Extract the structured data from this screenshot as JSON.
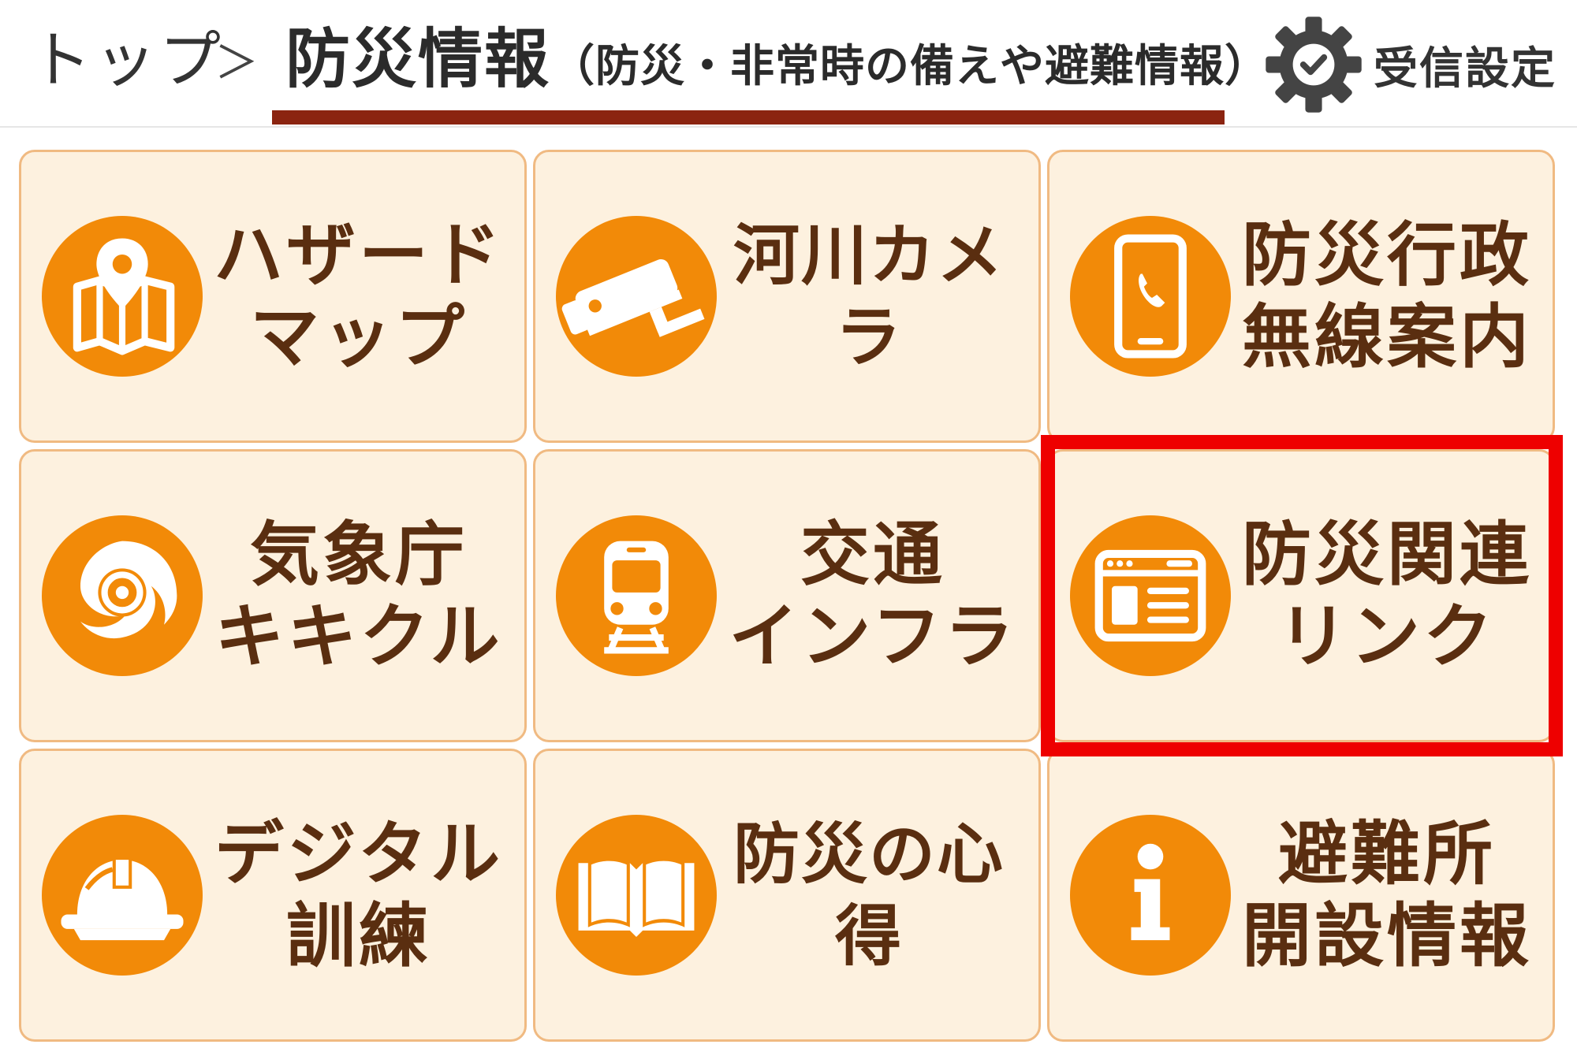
{
  "header": {
    "breadcrumb_top": "トップ",
    "separator": "＞",
    "current_title": "防災情報",
    "current_subtitle": "（防災・非常時の備えや避難情報）",
    "settings_label": "受信設定",
    "settings_icon": "gear-check-icon"
  },
  "colors": {
    "tile_bg": "#fdf1df",
    "tile_border": "#f0ba82",
    "icon_bg": "#f28a08",
    "label_text": "#5a2e10",
    "underline": "#8b2410",
    "highlight": "#ee0000"
  },
  "tiles": [
    {
      "label": "ハザード\nマップ",
      "icon": "map-pin-icon"
    },
    {
      "label": "河川カメラ",
      "icon": "security-camera-icon"
    },
    {
      "label": "防災行政\n無線案内",
      "icon": "smartphone-icon"
    },
    {
      "label": "気象庁\nキキクル",
      "icon": "typhoon-icon"
    },
    {
      "label": "交通\nインフラ",
      "icon": "train-icon"
    },
    {
      "label": "防災関連\nリンク",
      "icon": "browser-window-icon"
    },
    {
      "label": "デジタル\n訓練",
      "icon": "helmet-icon"
    },
    {
      "label": "防災の心得",
      "icon": "book-icon"
    },
    {
      "label": "避難所\n開設情報",
      "icon": "info-icon"
    }
  ],
  "highlighted_tile": "防災関連\nリンク"
}
